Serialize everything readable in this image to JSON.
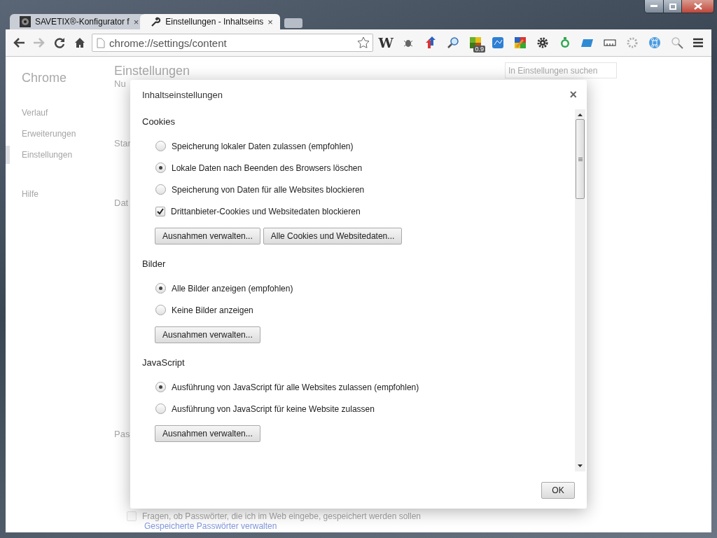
{
  "tabs": [
    {
      "title": "SAVETIX®-Konfigurator f",
      "close": "×",
      "selected": false
    },
    {
      "title": "Einstellungen - Inhaltseins",
      "close": "×",
      "selected": true
    }
  ],
  "address_bar": {
    "url": "chrome://settings/content"
  },
  "extensions": [
    {
      "kind": "letter",
      "text": "W"
    },
    {
      "kind": "bug"
    },
    {
      "kind": "arrows"
    },
    {
      "kind": "magnifier"
    },
    {
      "kind": "grid",
      "badge": "0.9"
    },
    {
      "kind": "seo"
    },
    {
      "kind": "pencil"
    },
    {
      "kind": "gear"
    },
    {
      "kind": "clock"
    },
    {
      "kind": "folder"
    },
    {
      "kind": "ruler"
    },
    {
      "kind": "cog"
    },
    {
      "kind": "command"
    },
    {
      "kind": "search"
    }
  ],
  "sidebar": {
    "title": "Chrome",
    "items": [
      {
        "label": "Verlauf",
        "selected": false
      },
      {
        "label": "Erweiterungen",
        "selected": false
      },
      {
        "label": "Einstellungen",
        "selected": true
      },
      {
        "label": "Hilfe",
        "selected": false
      }
    ]
  },
  "settings_page": {
    "heading": "Einstellungen",
    "search": {
      "placeholder": "In Einstellungen suchen"
    },
    "section_fragments": [
      "Nu",
      "Star",
      "Dat",
      "Pas"
    ],
    "password_option": {
      "label": "Fragen, ob Passwörter, die ich im Web eingebe, gespeichert werden sollen",
      "checked": false
    },
    "link": "Gespeicherte Passwörter verwalten"
  },
  "dialog": {
    "title": "Inhaltseinstellungen",
    "close": "×",
    "sections": [
      {
        "heading": "Cookies",
        "options": [
          {
            "kind": "radio",
            "label": "Speicherung lokaler Daten zulassen (empfohlen)",
            "selected": false
          },
          {
            "kind": "radio",
            "label": "Lokale Daten nach Beenden des Browsers löschen",
            "selected": true
          },
          {
            "kind": "radio",
            "label": "Speicherung von Daten für alle Websites blockieren",
            "selected": false
          },
          {
            "kind": "checkbox",
            "label": "Drittanbieter-Cookies und Websitedaten blockieren",
            "checked": true
          }
        ],
        "buttons": [
          "Ausnahmen verwalten...",
          "Alle Cookies und Websitedaten..."
        ]
      },
      {
        "heading": "Bilder",
        "options": [
          {
            "kind": "radio",
            "label": "Alle Bilder anzeigen (empfohlen)",
            "selected": true
          },
          {
            "kind": "radio",
            "label": "Keine Bilder anzeigen",
            "selected": false
          }
        ],
        "buttons": [
          "Ausnahmen verwalten..."
        ]
      },
      {
        "heading": "JavaScript",
        "options": [
          {
            "kind": "radio",
            "label": "Ausführung von JavaScript für alle Websites zulassen (empfohlen)",
            "selected": true
          },
          {
            "kind": "radio",
            "label": "Ausführung von JavaScript für keine Website zulassen",
            "selected": false
          }
        ],
        "buttons": [
          "Ausnahmen verwalten..."
        ]
      }
    ],
    "ok": "OK"
  }
}
